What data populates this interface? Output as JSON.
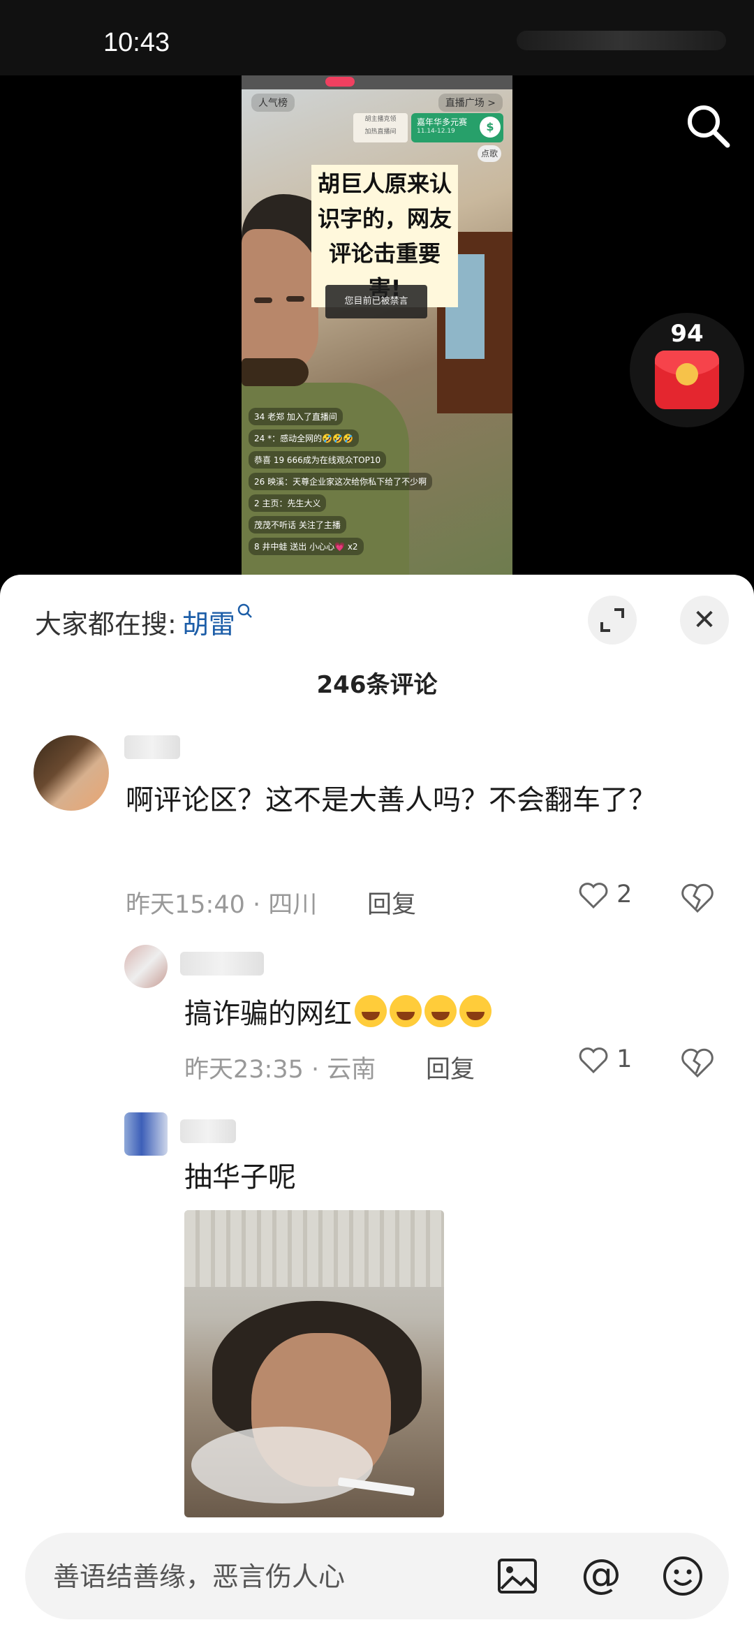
{
  "status_bar": {
    "time": "10:43"
  },
  "video": {
    "popularity": "人气榜",
    "live_plaza": "直播广场 >",
    "anchor_card": [
      "胡主播克领",
      "加热直播间"
    ],
    "promo": {
      "title": "嘉年华多元赛",
      "dates": "11.14-12.19"
    },
    "order": "点歌",
    "caption": "胡巨人原来认识字的，网友评论击重要害!",
    "muted_notice": "您目前已被禁言",
    "chat": [
      "34 老郑 加入了直播间",
      "24 *：感动全网的🤣🤣🤣",
      "恭喜 19 666成为在线观众TOP10",
      "26 映溪：天尊企业家这次给你私下给了不少啊",
      "2 主页：先生大义",
      "茂茂不听话 关注了主播",
      "8 井中蛙 送出 小心心💗 x2"
    ]
  },
  "redpacket": {
    "count": "94"
  },
  "comments_sheet": {
    "hot_search_label": "大家都在搜:",
    "hot_search_term": "胡雷",
    "count_label": "246条评论",
    "comments": [
      {
        "text": "啊评论区？这不是大善人吗？不会翻车了？",
        "time": "昨天15:40",
        "location": "四川",
        "reply": "回复",
        "likes": "2"
      },
      {
        "text": "搞诈骗的网红",
        "time": "昨天23:35",
        "location": "云南",
        "reply": "回复",
        "likes": "1"
      },
      {
        "text": "抽华子呢"
      }
    ]
  },
  "input": {
    "placeholder": "善语结善缘，恶言伤人心"
  },
  "colors": {
    "hot_term": "#1d5ea8",
    "redpacket": "#e4262f"
  }
}
